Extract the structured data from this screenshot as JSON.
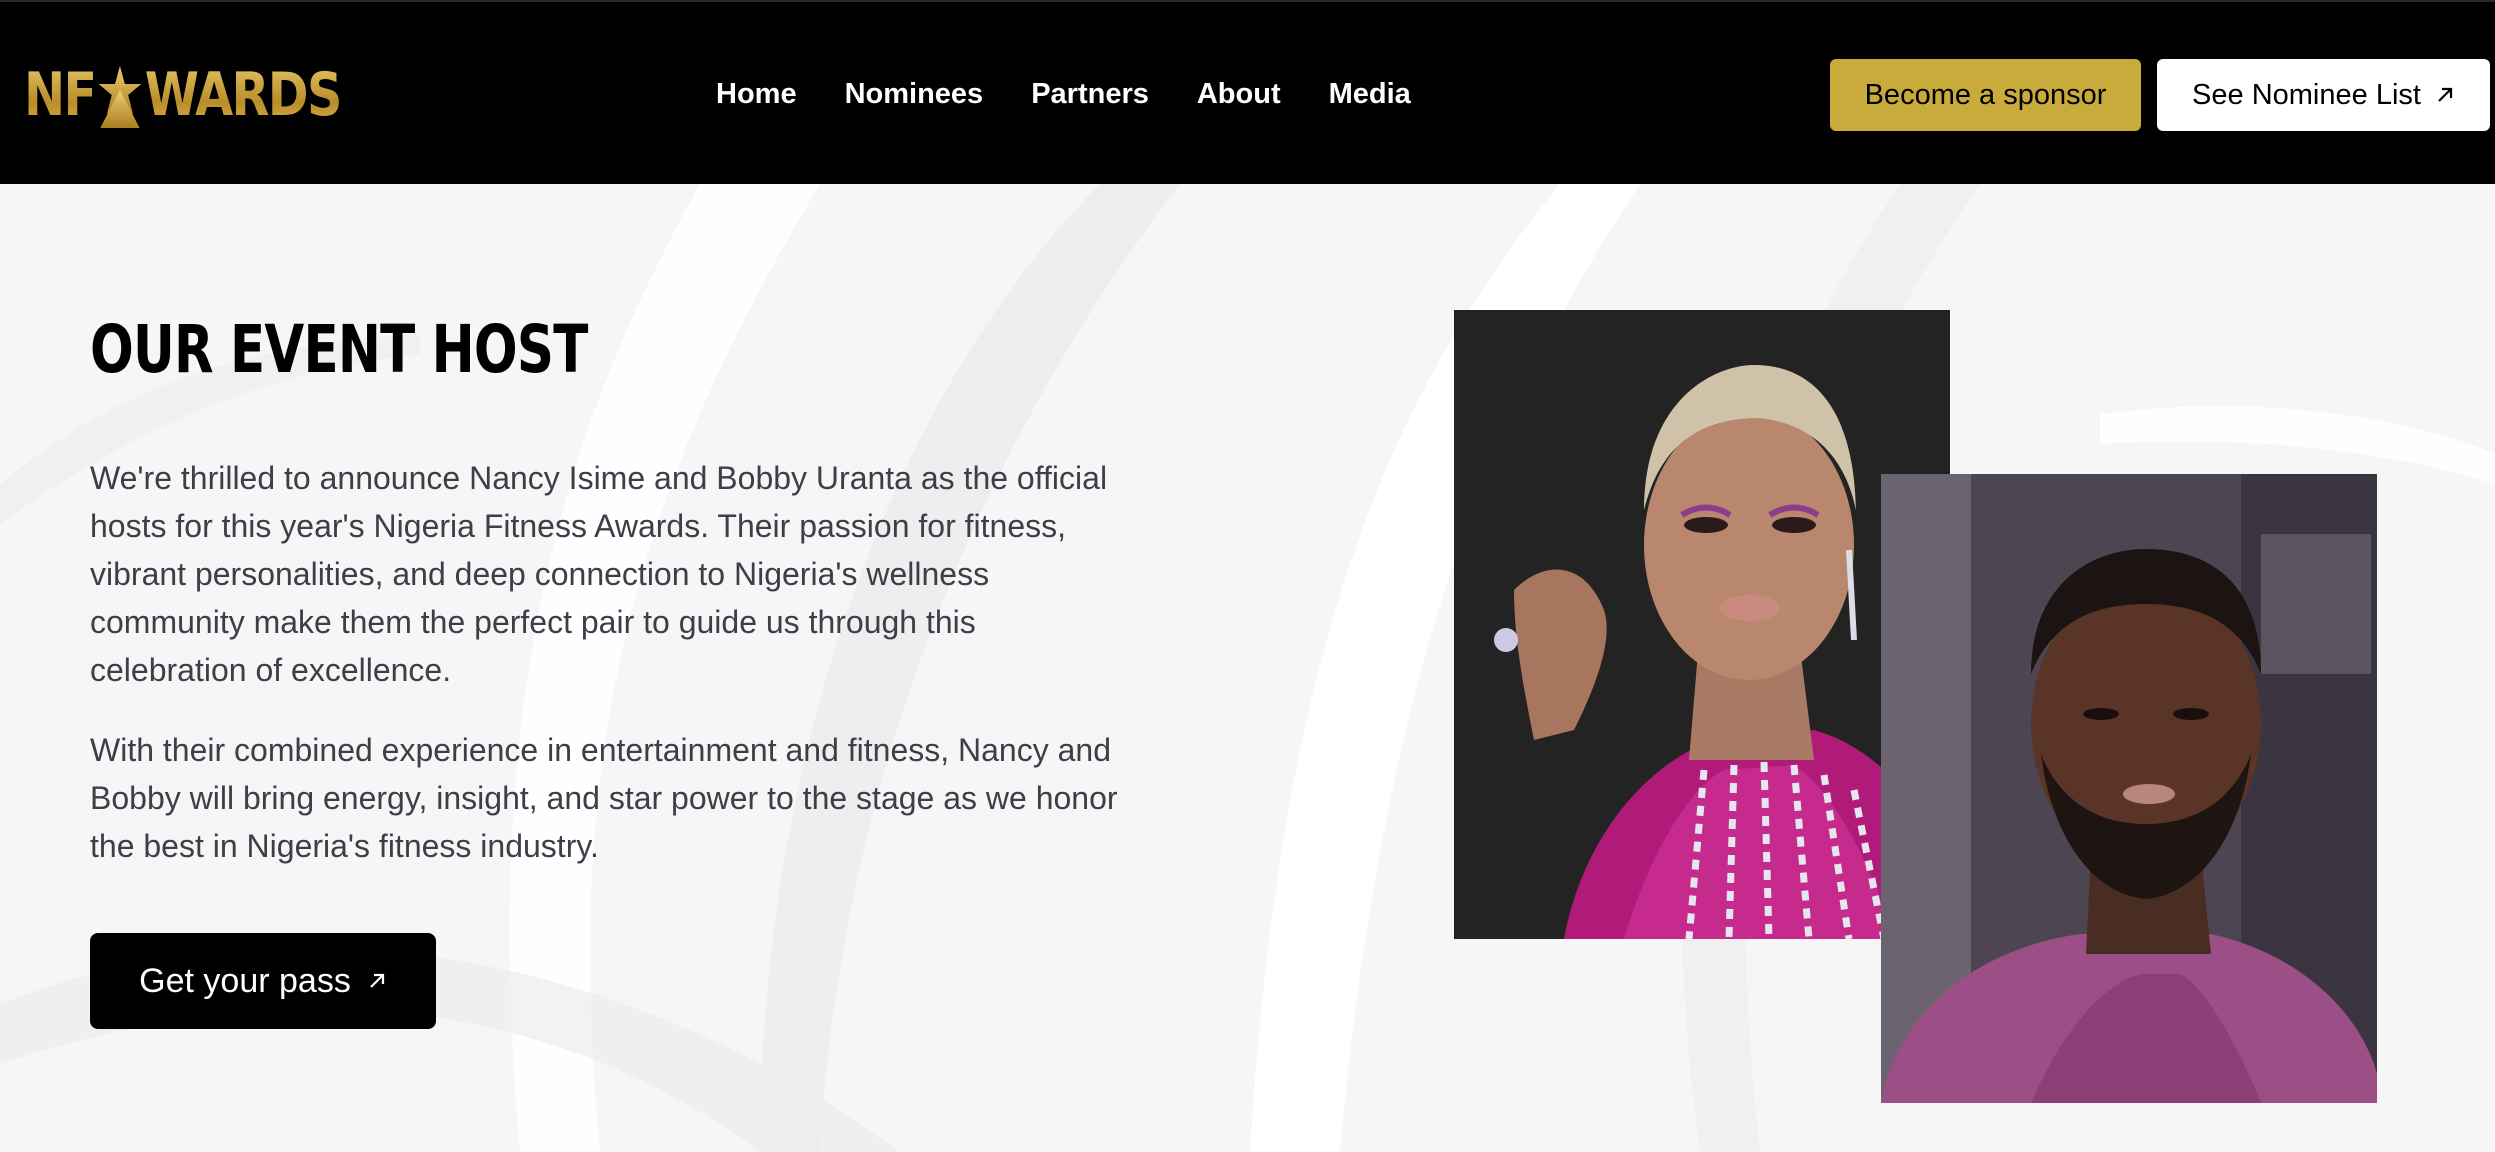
{
  "header": {
    "logo_text_left": "NF",
    "logo_text_right": "WARDS",
    "nav": [
      "Home",
      "Nominees",
      "Partners",
      "About",
      "Media"
    ],
    "sponsor_label": "Become a sponsor",
    "nominee_label": "See Nominee List",
    "colors": {
      "background": "#000000",
      "gold": "#c9ab3b"
    }
  },
  "host_section": {
    "title": "OUR EVENT HOST",
    "paragraph_1": "We're thrilled to announce Nancy Isime and Bobby Uranta as the official hosts for this year's Nigeria Fitness Awards. Their passion for fitness, vibrant personalities, and deep connection to Nigeria's wellness community make them the perfect pair to guide us through this celebration of excellence.",
    "paragraph_2": "With their combined experience in entertainment and fitness, Nancy and Bobby will bring energy, insight, and star power to the stage as we honor the best in Nigeria's fitness industry.",
    "cta_label": "Get your pass",
    "photos": [
      "host-photo-nancy",
      "host-photo-bobby"
    ]
  },
  "icons": [
    "star-logo-icon",
    "arrow-up-right-icon"
  ]
}
